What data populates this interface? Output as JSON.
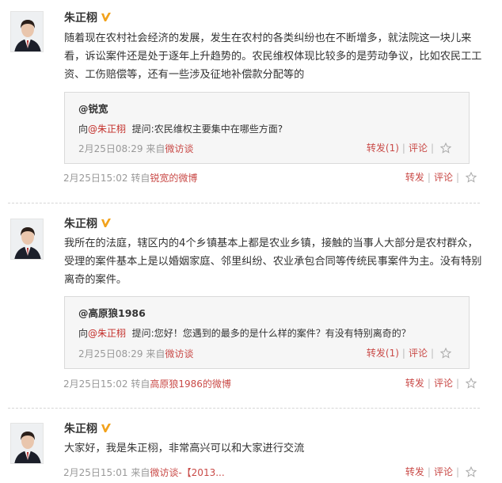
{
  "colors": {
    "link": "#c94a47",
    "mention": "#c4312c",
    "muted": "#999999",
    "quote_bg": "#f6f6f6",
    "border": "#dadada"
  },
  "posts": [
    {
      "username": "朱正栩",
      "badge_icon": "verified-v-icon",
      "text": "随着现在农村社会经济的发展，发生在农村的各类纠纷也在不断增多，就法院这一块儿来看，诉讼案件还是处于逐年上升趋势的。农民维权体现比较多的是劳动争议，比如农民工工资、工伤赔偿等，还有一些涉及征地补偿款分配等的",
      "quote": {
        "author": "@锐宽",
        "prefix": "向",
        "mention": "@朱正栩",
        "question": "提问:农民维权主要集中在哪些方面?",
        "time": "2月25日08:29",
        "source_prefix": "来自",
        "source": "微访谈",
        "repost": "转发(1)",
        "comment": "评论"
      },
      "time": "2月25日15:02",
      "forward_prefix": "转自",
      "forward_from": "锐宽的微博",
      "repost": "转发",
      "comment": "评论"
    },
    {
      "username": "朱正栩",
      "badge_icon": "verified-v-icon",
      "text": "我所在的法庭，辖区内的4个乡镇基本上都是农业乡镇，接触的当事人大部分是农村群众，受理的案件基本上是以婚姻家庭、邻里纠纷、农业承包合同等传统民事案件为主。没有特别离奇的案件。",
      "quote": {
        "author": "@高原狼1986",
        "prefix": "向",
        "mention": "@朱正栩",
        "question": "提问:您好！您遇到的最多的是什么样的案件？有没有特别离奇的？",
        "time": "2月25日08:29",
        "source_prefix": "来自",
        "source": "微访谈",
        "repost": "转发(1)",
        "comment": "评论"
      },
      "time": "2月25日15:02",
      "forward_prefix": "转自",
      "forward_from": "高原狼1986的微博",
      "repost": "转发",
      "comment": "评论"
    },
    {
      "username": "朱正栩",
      "badge_icon": "verified-v-icon",
      "text": "大家好，我是朱正栩，非常高兴可以和大家进行交流",
      "time": "2月25日15:01",
      "source_prefix": "来自",
      "source": "微访谈-【2013...",
      "repost": "转发",
      "comment": "评论"
    }
  ]
}
